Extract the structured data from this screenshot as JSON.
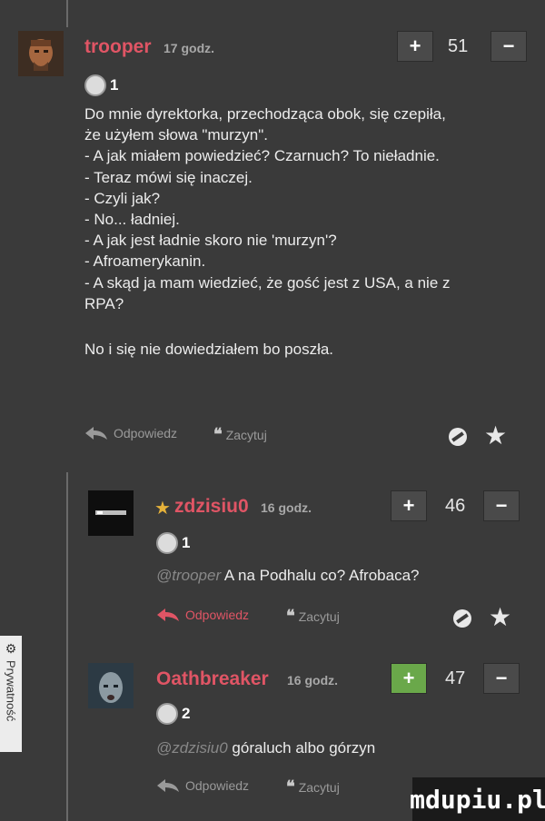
{
  "comments": [
    {
      "username": "trooper",
      "time": "17 godz.",
      "score": "51",
      "badge_count": "1",
      "lines": [
        "Do mnie dyrektorka, przechodząca obok, się czepiła,",
        "że użyłem słowa \"murzyn\".",
        "- A jak miałem powiedzieć? Czarnuch? To nieładnie.",
        "- Teraz mówi się inaczej.",
        "- Czyli jak?",
        "- No... ładniej.",
        "- A jak jest ładnie skoro nie 'murzyn'?",
        "- Afroamerykanin.",
        "- A skąd ja mam wiedzieć, że gość jest z USA, a nie z",
        "RPA?",
        "",
        "No i się nie dowiedziałem bo poszła."
      ],
      "reply_label": "Odpowiedz",
      "quote_label": "Zacytuj"
    },
    {
      "username": "zdzisiu0",
      "time": "16 godz.",
      "score": "46",
      "badge_count": "1",
      "mention": "@trooper",
      "text": "A na Podhalu co? Afrobaca?",
      "reply_label": "Odpowiedz",
      "quote_label": "Zacytuj"
    },
    {
      "username": "Oathbreaker",
      "time": "16 godz.",
      "score": "47",
      "badge_count": "2",
      "mention": "@zdzisiu0",
      "text": "góraluch albo górzyn",
      "reply_label": "Odpowiedz",
      "quote_label": "Zacytuj"
    }
  ],
  "vote_plus": "+",
  "vote_minus": "−",
  "star": "★",
  "privacy_tab_label": "Prywatność",
  "watermark": "mdupiu.pl",
  "colors": {
    "background": "#3a3a3a",
    "username": "#e05565",
    "plus_active": "#6aa84a",
    "vote_button": "#4a4a4a"
  },
  "icons": [
    "reply-arrow-icon",
    "quote-icon",
    "no-entry-icon",
    "star-icon",
    "badge-icon",
    "gear-icon"
  ]
}
